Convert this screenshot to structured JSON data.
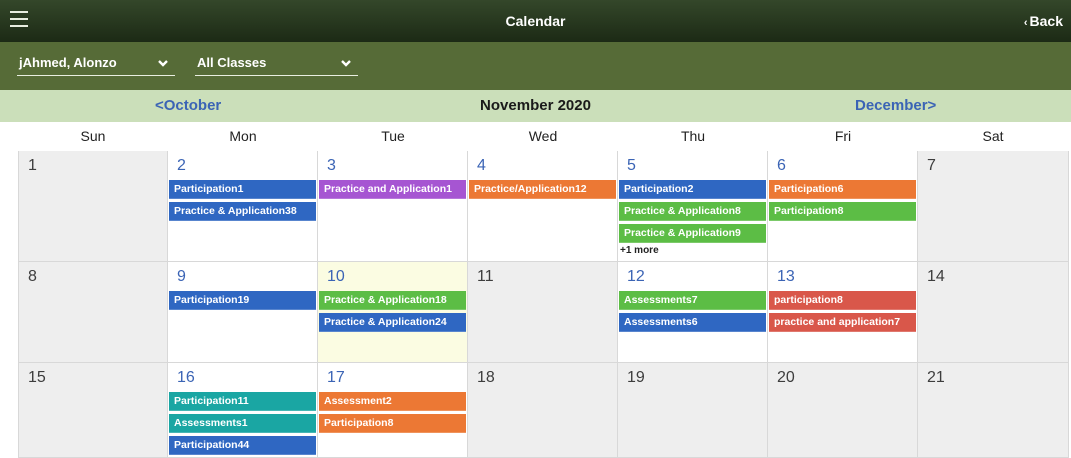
{
  "header": {
    "title": "Calendar",
    "back_label": "Back"
  },
  "filters": {
    "student": "jAhmed, Alonzo",
    "classes": "All Classes"
  },
  "month_nav": {
    "prev": "<October",
    "current": "November 2020",
    "next": "December>"
  },
  "weekdays": [
    "Sun",
    "Mon",
    "Tue",
    "Wed",
    "Thu",
    "Fri",
    "Sat"
  ],
  "colors": {
    "blue": "#2f67c2",
    "purple": "#a655d2",
    "orange": "#ec7834",
    "green": "#5cbd45",
    "teal": "#1aa6a3",
    "red": "#d9574a"
  },
  "weeks": [
    [
      {
        "day": "1",
        "weekend": true,
        "events": []
      },
      {
        "day": "2",
        "events": [
          {
            "label": "Participation1",
            "color": "blue"
          },
          {
            "label": "Practice & Application38",
            "color": "blue"
          }
        ]
      },
      {
        "day": "3",
        "events": [
          {
            "label": "Practice and Application1",
            "color": "purple"
          }
        ]
      },
      {
        "day": "4",
        "events": [
          {
            "label": "Practice/Application12",
            "color": "orange"
          }
        ]
      },
      {
        "day": "5",
        "events": [
          {
            "label": "Participation2",
            "color": "blue"
          },
          {
            "label": "Practice & Application8",
            "color": "green"
          },
          {
            "label": "Practice & Application9",
            "color": "green"
          }
        ],
        "more": "+1 more"
      },
      {
        "day": "6",
        "events": [
          {
            "label": "Participation6",
            "color": "orange"
          },
          {
            "label": "Participation8",
            "color": "green"
          }
        ]
      },
      {
        "day": "7",
        "weekend": true,
        "events": []
      }
    ],
    [
      {
        "day": "8",
        "weekend": true,
        "events": []
      },
      {
        "day": "9",
        "events": [
          {
            "label": "Participation19",
            "color": "blue"
          }
        ]
      },
      {
        "day": "10",
        "today": true,
        "events": [
          {
            "label": "Practice & Application18",
            "color": "green"
          },
          {
            "label": "Practice & Application24",
            "color": "blue"
          }
        ]
      },
      {
        "day": "11",
        "weekend": true,
        "events": []
      },
      {
        "day": "12",
        "events": [
          {
            "label": "Assessments7",
            "color": "green"
          },
          {
            "label": "Assessments6",
            "color": "blue"
          }
        ]
      },
      {
        "day": "13",
        "events": [
          {
            "label": "participation8",
            "color": "red"
          },
          {
            "label": "practice and application7",
            "color": "red"
          }
        ]
      },
      {
        "day": "14",
        "weekend": true,
        "events": []
      }
    ],
    [
      {
        "day": "15",
        "weekend": true,
        "events": []
      },
      {
        "day": "16",
        "events": [
          {
            "label": "Participation11",
            "color": "teal"
          },
          {
            "label": "Assessments1",
            "color": "teal"
          },
          {
            "label": "Participation44",
            "color": "blue"
          }
        ]
      },
      {
        "day": "17",
        "events": [
          {
            "label": "Assessment2",
            "color": "orange"
          },
          {
            "label": "Participation8",
            "color": "orange"
          }
        ]
      },
      {
        "day": "18",
        "weekend": true,
        "events": []
      },
      {
        "day": "19",
        "weekend": true,
        "events": []
      },
      {
        "day": "20",
        "weekend": true,
        "events": []
      },
      {
        "day": "21",
        "weekend": true,
        "events": []
      }
    ]
  ]
}
